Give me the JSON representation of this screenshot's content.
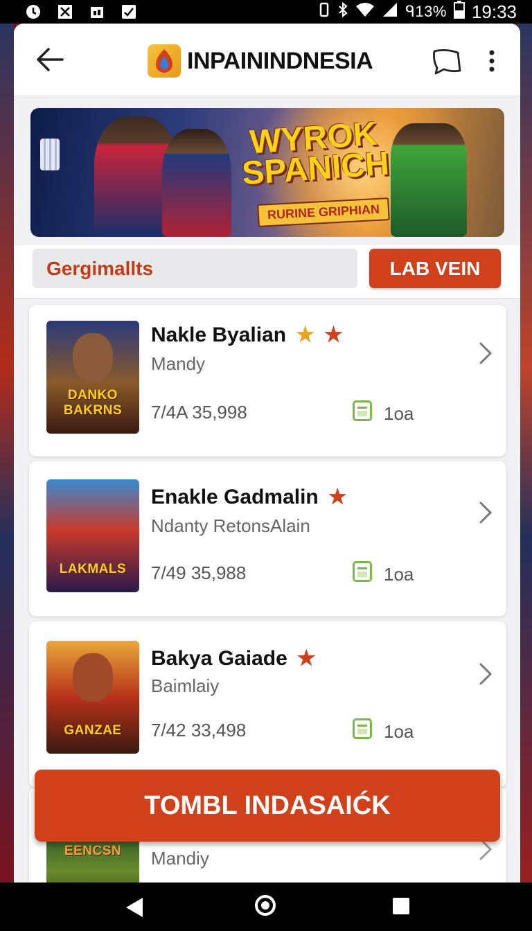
{
  "status_bar": {
    "left_icons": [
      "clock-icon",
      "x-box-icon",
      "notification-icon",
      "check-box-icon"
    ],
    "right_icons": [
      "vibrate-icon",
      "bluetooth-icon",
      "wifi-icon",
      "signal-icon",
      "battery-icon"
    ],
    "battery_text": "ᑫ13%",
    "time": "19:33"
  },
  "app_bar": {
    "title": "INPAININDNESIA",
    "back_icon": "back-arrow-icon",
    "chat_icon": "chat-bubble-icon",
    "menu_icon": "more-vert-icon"
  },
  "banner": {
    "title": "WYROK SPANICH",
    "subtitle": "RURINE GRIPHIAN"
  },
  "search": {
    "value": "Gergimallts",
    "button_label": "LAB VEIN"
  },
  "items": [
    {
      "name": "Nakle Byalian",
      "stars": [
        "gold",
        "red"
      ],
      "subtitle": "Mandy",
      "meta": "7/4A 35,998",
      "count": "1oa",
      "thumb_text": "DANKO BAKRNS"
    },
    {
      "name": "Enakle Gadmalin",
      "stars": [
        "red"
      ],
      "subtitle": "Ndanty RetonsAlain",
      "meta": "7/49 35,988",
      "count": "1oa",
      "thumb_text": "LAKMALS"
    },
    {
      "name": "Bakya Gaiade",
      "stars": [
        "red"
      ],
      "subtitle": "Baimlaiy",
      "meta": "7/42 33,498",
      "count": "1oa",
      "thumb_text": "GANZAE"
    },
    {
      "name": "",
      "stars": [],
      "subtitle": "Mandiy",
      "meta": "",
      "count": "",
      "thumb_text": "EENCSN"
    }
  ],
  "cta": {
    "label": "TOMBL INDASAIĆK"
  },
  "colors": {
    "accent": "#d0401a",
    "star_gold": "#e8a71a",
    "calendar_green": "#7ab84a"
  },
  "nav": {
    "back_icon": "nav-back-icon",
    "home_icon": "nav-home-icon",
    "recent_icon": "nav-recents-icon"
  }
}
